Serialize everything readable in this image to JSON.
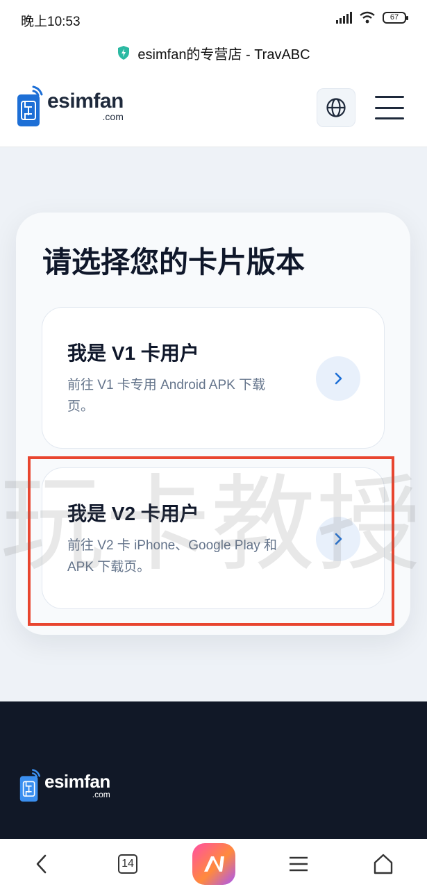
{
  "status_bar": {
    "time": "晚上10:53",
    "battery": "67"
  },
  "url_bar": {
    "site_title": "esimfan的专营店 - TravABC"
  },
  "header": {
    "logo_word": "esimfan",
    "logo_dotcom": ".com"
  },
  "main": {
    "title": "请选择您的卡片版本",
    "options": [
      {
        "title": "我是 V1 卡用户",
        "desc": "前往 V1 卡专用 Android APK 下载页。"
      },
      {
        "title": "我是 V2 卡用户",
        "desc": "前往 V2 卡 iPhone、Google Play 和 APK 下载页。"
      }
    ]
  },
  "watermark": "玩卡教授",
  "footer": {
    "logo_word": "esimfan",
    "logo_dotcom": ".com"
  },
  "bottom_nav": {
    "tabs_count": "14"
  },
  "colors": {
    "highlight": "#e8452f",
    "footer_bg": "#111827",
    "accent": "#1d6fd6"
  }
}
